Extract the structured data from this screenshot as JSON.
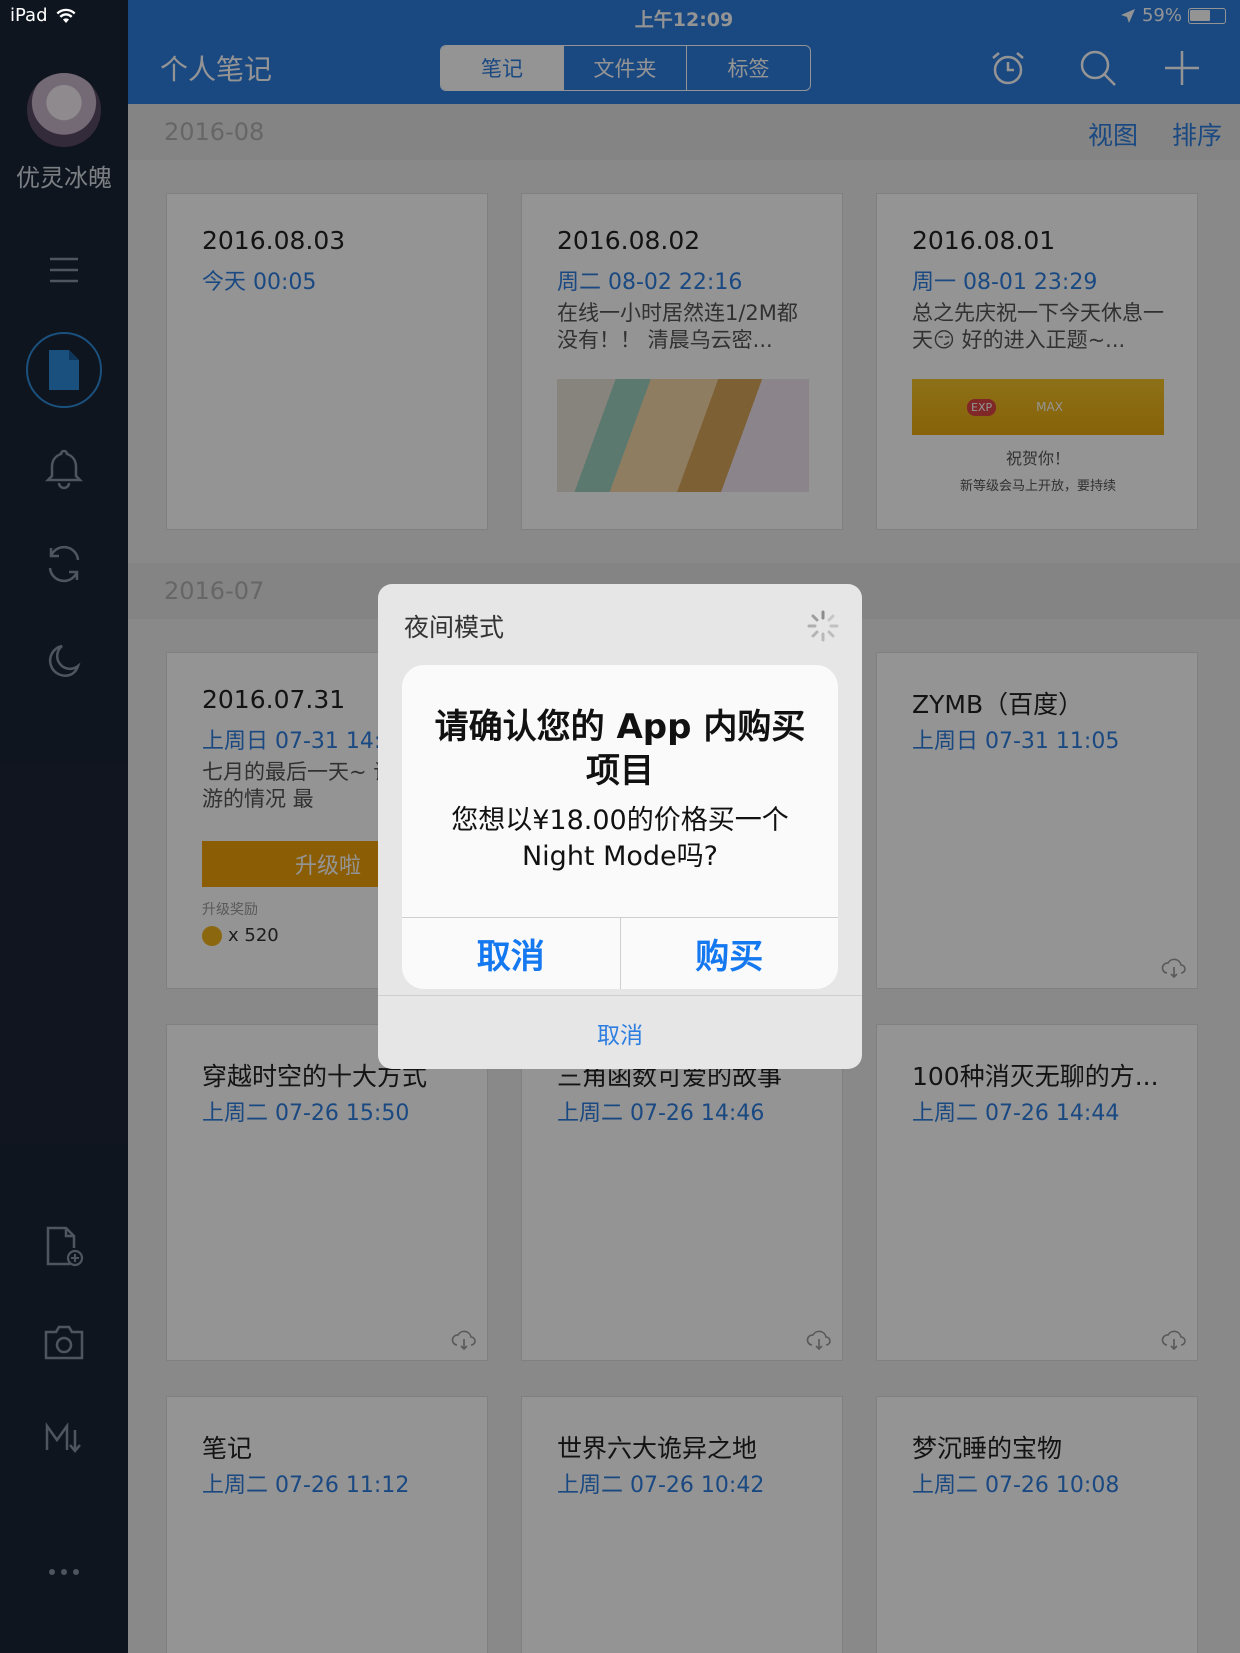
{
  "status": {
    "device": "iPad",
    "time": "上午12:09",
    "battery": "59%"
  },
  "sidebar": {
    "username": "优灵冰魄"
  },
  "header": {
    "title": "个人笔记",
    "segments": [
      "笔记",
      "文件夹",
      "标签"
    ]
  },
  "section_aug": {
    "date": "2016-08",
    "view_label": "视图",
    "sort_label": "排序"
  },
  "section_jul": {
    "date": "2016-07"
  },
  "cards": [
    {
      "title": "2016.08.03",
      "date": "今天 00:05",
      "excerpt": ""
    },
    {
      "title": "2016.08.02",
      "date": "周二 08-02 22:16",
      "excerpt": "在线一小时居然连1/2M都没有！！ 清晨乌云密..."
    },
    {
      "title": "2016.08.01",
      "date": "周一 08-01 23:29",
      "excerpt": "总之先庆祝一下今天休息一天😏 好的进入正题~..."
    },
    {
      "title": "2016.07.31",
      "date": "上周日 07-31 14:",
      "excerpt": "七月的最后一天~ 谈谈音游的情况 最"
    },
    {
      "title": "",
      "date": "",
      "excerpt": ""
    },
    {
      "title": "ZYMB（百度）",
      "date": "上周日 07-31 11:05",
      "excerpt": ""
    },
    {
      "title": "穿越时空的十大方式",
      "date": "上周二 07-26 15:50",
      "excerpt": ""
    },
    {
      "title": "三角函数可爱的故事",
      "date": "上周二 07-26 14:46",
      "excerpt": ""
    },
    {
      "title": "100种消灭无聊的方...",
      "date": "上周二 07-26 14:44",
      "excerpt": ""
    },
    {
      "title": "笔记",
      "date": "上周二 07-26 11:12",
      "excerpt": ""
    },
    {
      "title": "世界六大诡异之地",
      "date": "上周二 07-26 10:42",
      "excerpt": ""
    },
    {
      "title": "梦沉睡的宝物",
      "date": "上周二 07-26 10:08",
      "excerpt": ""
    }
  ],
  "thumbs": {
    "game_upgrade": "升级啦",
    "game_reward": "升级奖励",
    "game_count": "x 520",
    "exp_badge": "EXP",
    "exp_max": "MAX",
    "exp_congrats": "祝贺你！",
    "exp_note": "新等级会马上开放，要持续"
  },
  "sheet": {
    "title": "夜间模式",
    "cancel_label": "取消"
  },
  "alert": {
    "title": "请确认您的 App 内购买项目",
    "message": "您想以¥18.00的价格买一个Night Mode吗?",
    "cancel_label": "取消",
    "buy_label": "购买"
  },
  "colors": {
    "accent": "#2d7ee0",
    "sidebar": "#1b2535",
    "ios_blue": "#1478f0"
  }
}
